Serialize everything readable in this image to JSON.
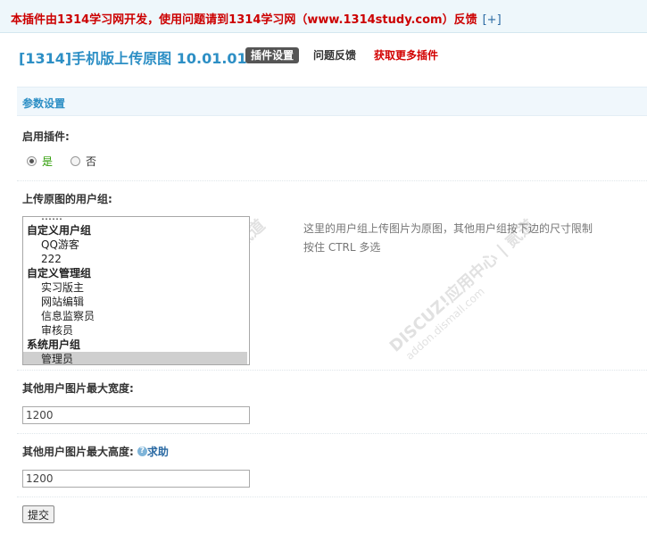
{
  "topbar": {
    "notice": "本插件由1314学习网开发，使用问题请到1314学习网（www.1314study.com）反馈",
    "expand": "[+]"
  },
  "header": {
    "title": "[1314]手机版上传原图 10.01.01",
    "tabs": [
      {
        "label": "插件设置",
        "active": true
      },
      {
        "label": "问题反馈",
        "active": false
      },
      {
        "label": "获取更多插件",
        "active": false
      }
    ]
  },
  "section": {
    "title": "参数设置"
  },
  "fields": {
    "enable": {
      "label": "启用插件:",
      "options": [
        {
          "label": "是",
          "checked": true
        },
        {
          "label": "否",
          "checked": false
        }
      ]
    },
    "usergroups": {
      "label": "上传原图的用户组:",
      "hint_line1": "这里的用户组上传图片为原图，其他用户组按下边的尺寸限制",
      "hint_line2": "按住 CTRL 多选",
      "options": [
        {
          "label": "……",
          "type": "item",
          "selected": false
        },
        {
          "label": "自定义用户组",
          "type": "group",
          "selected": false
        },
        {
          "label": "QQ游客",
          "type": "item",
          "selected": false
        },
        {
          "label": "222",
          "type": "item",
          "selected": false
        },
        {
          "label": "自定义管理组",
          "type": "group",
          "selected": false
        },
        {
          "label": "实习版主",
          "type": "item",
          "selected": false
        },
        {
          "label": "网站编辑",
          "type": "item",
          "selected": false
        },
        {
          "label": "信息监察员",
          "type": "item",
          "selected": false
        },
        {
          "label": "审核员",
          "type": "item",
          "selected": false
        },
        {
          "label": "系统用户组",
          "type": "group",
          "selected": false
        },
        {
          "label": "管理员",
          "type": "item",
          "selected": true
        }
      ]
    },
    "max_width": {
      "label": "其他用户图片最大宽度:",
      "value": "1200"
    },
    "max_height": {
      "label": "其他用户图片最大高度:",
      "value": "1200",
      "help": "求助"
    }
  },
  "submit": {
    "label": "提交"
  },
  "watermark": {
    "brand": "DISCUZ!应用中心 | 贰道",
    "url": "addon.dismall.com"
  },
  "icons": {
    "help": "help-icon"
  }
}
